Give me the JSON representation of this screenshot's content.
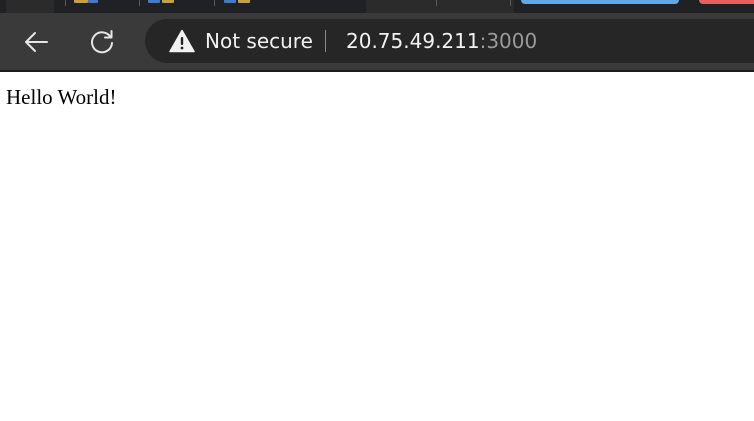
{
  "browser": {
    "security": {
      "icon": "warning-triangle-icon",
      "label": "Not secure"
    },
    "address": {
      "host": "20.75.49.211",
      "port": ":3000"
    },
    "nav": {
      "back_icon": "back-arrow-icon",
      "reload_icon": "reload-icon"
    },
    "colors": {
      "toolbar": "#3a3a3a",
      "addressbar": "#262626",
      "tab_pill_blue": "#62a8e6",
      "tab_pill_red": "#e8605c"
    }
  },
  "page": {
    "body_text": "Hello World!"
  }
}
